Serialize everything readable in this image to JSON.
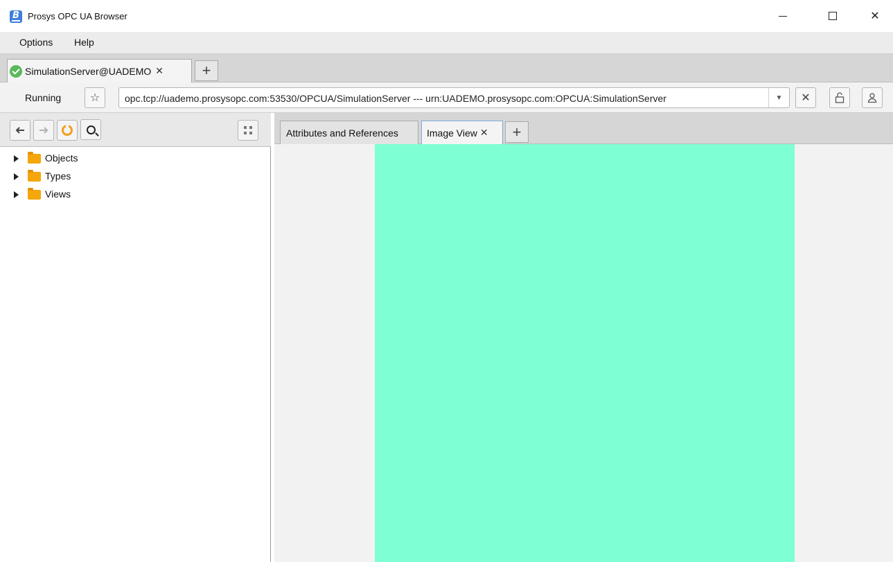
{
  "app": {
    "title": "Prosys OPC UA Browser",
    "icon": "B"
  },
  "window_controls": {
    "minimize": "minimize-icon",
    "maximize": "maximize-icon",
    "close": "✕"
  },
  "menu": {
    "items": [
      {
        "label": "Options"
      },
      {
        "label": "Help"
      }
    ]
  },
  "server_tabs": {
    "active": {
      "label": "SimulationServer@UADEMO",
      "status_icon": "check-circle-icon",
      "close": "✕"
    },
    "add": "+"
  },
  "address_bar": {
    "status": "Running",
    "url": "opc.tcp://uademo.prosysopc.com:53530/OPCUA/SimulationServer --- urn:UADEMO.prosysopc.com:OPCUA:SimulationServer",
    "star": "☆",
    "dropdown": "▼",
    "disconnect": "✕",
    "lock": "🔓",
    "user": "👤"
  },
  "nav_toolbar": {
    "back": "🡐",
    "forward": "🡒"
  },
  "tree": {
    "items": [
      {
        "label": "Objects"
      },
      {
        "label": "Types"
      },
      {
        "label": "Views"
      }
    ]
  },
  "detail_tabs": {
    "tabs": [
      {
        "label": "Attributes and References"
      },
      {
        "label": "Image View",
        "close": "✕"
      }
    ],
    "add": "+"
  },
  "image_view": {
    "color": "#7fffd4"
  }
}
